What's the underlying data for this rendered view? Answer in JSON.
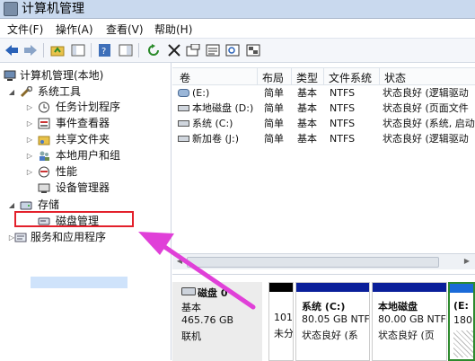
{
  "window": {
    "title": "计算机管理"
  },
  "menu": [
    "文件(F)",
    "操作(A)",
    "查看(V)",
    "帮助(H)"
  ],
  "tree": {
    "root": "计算机管理(本地)",
    "system_tools": "系统工具",
    "task_scheduler": "任务计划程序",
    "event_viewer": "事件查看器",
    "shared_folders": "共享文件夹",
    "local_users": "本地用户和组",
    "performance": "性能",
    "device_manager": "设备管理器",
    "storage": "存储",
    "disk_management": "磁盘管理",
    "services_apps": "服务和应用程序"
  },
  "columns": [
    "卷",
    "布局",
    "类型",
    "文件系统",
    "状态"
  ],
  "volumes": [
    {
      "name": "(E:)",
      "layout": "简单",
      "type": "基本",
      "fs": "NTFS",
      "status": "状态良好 (逻辑驱动"
    },
    {
      "name": "本地磁盘 (D:)",
      "layout": "简单",
      "type": "基本",
      "fs": "NTFS",
      "status": "状态良好 (页面文件"
    },
    {
      "name": "系统 (C:)",
      "layout": "简单",
      "type": "基本",
      "fs": "NTFS",
      "status": "状态良好 (系统, 启动"
    },
    {
      "name": "新加卷 (J:)",
      "layout": "简单",
      "type": "基本",
      "fs": "NTFS",
      "status": "状态良好 (逻辑驱动"
    }
  ],
  "disk0": {
    "name": "磁盘 0",
    "type": "基本",
    "size": "465.76 GB",
    "state": "联机",
    "partitions": [
      {
        "l1": "101",
        "l2": "未分"
      },
      {
        "title": "系统 (C:)",
        "size": "80.05 GB NTF",
        "status": "状态良好 (系"
      },
      {
        "title": "本地磁盘",
        "size": "80.00 GB NTF",
        "status": "状态良好 (页"
      },
      {
        "title": "(E:",
        "size": "180."
      }
    ]
  },
  "colors": {
    "highlight_box": "#e3202b",
    "arrow": "#e040d8",
    "primary_bar": "#0a1f9a",
    "extended_border": "#2d8a2d"
  }
}
